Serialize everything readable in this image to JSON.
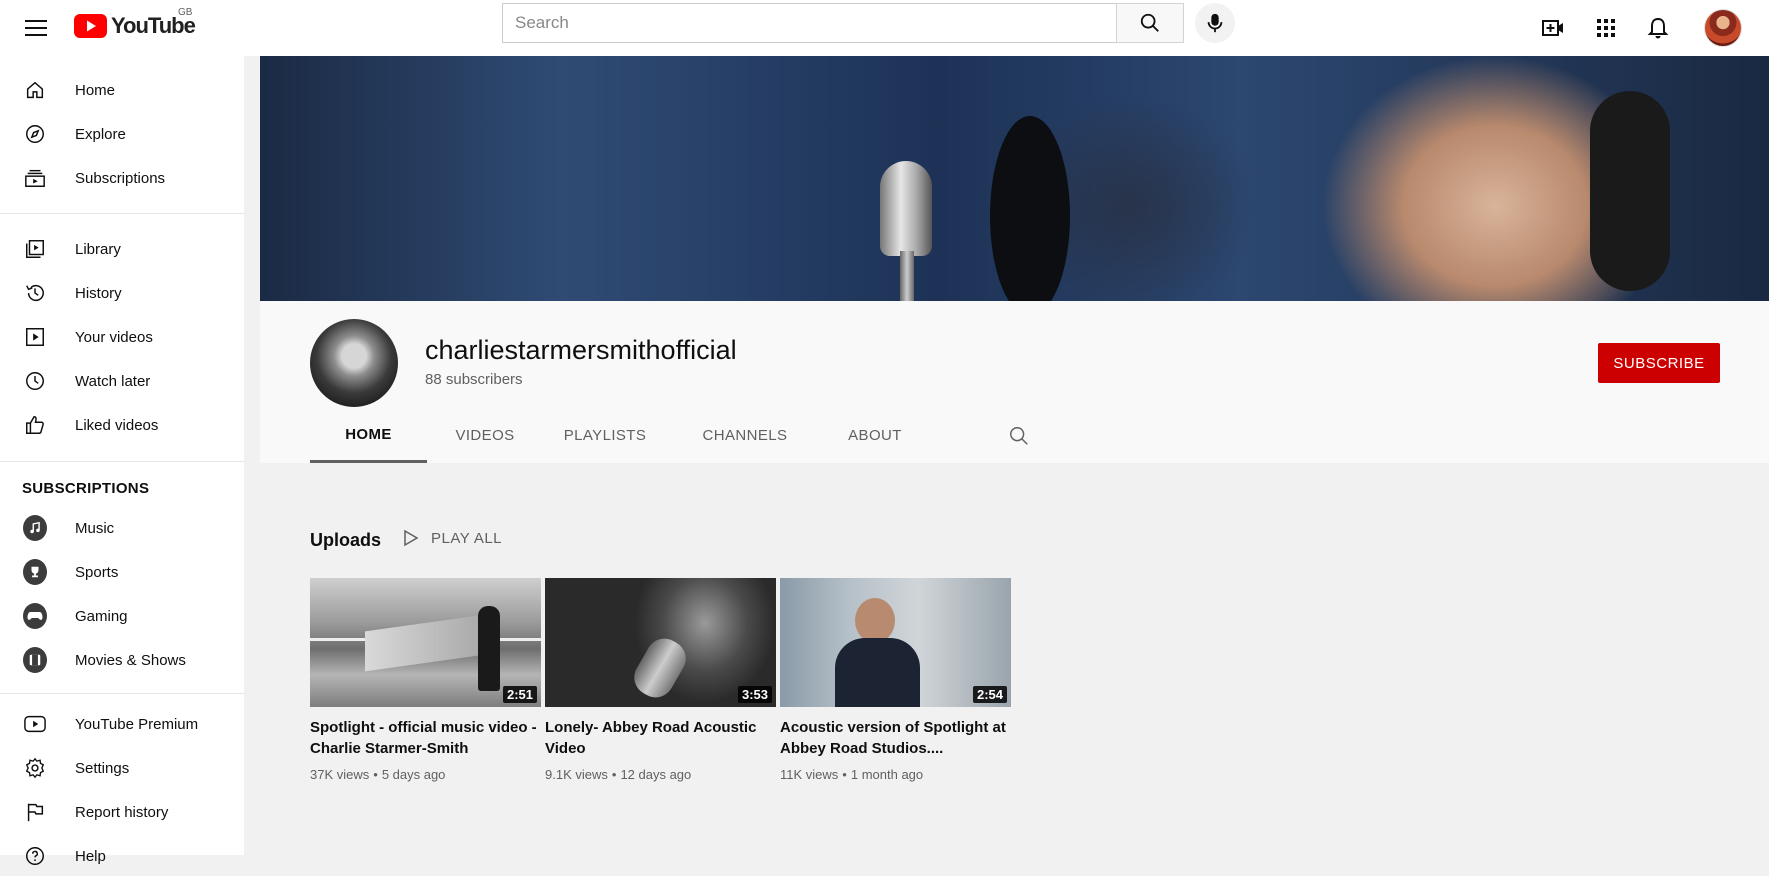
{
  "header": {
    "logo_word": "YouTube",
    "region": "GB",
    "search_placeholder": "Search",
    "icons": [
      "menu-icon",
      "search-icon",
      "mic-icon",
      "create-video-icon",
      "apps-icon",
      "bell-icon"
    ]
  },
  "sidebar": {
    "main": [
      {
        "label": "Home",
        "icon": "home-icon"
      },
      {
        "label": "Explore",
        "icon": "compass-icon"
      },
      {
        "label": "Subscriptions",
        "icon": "subscriptions-icon"
      }
    ],
    "library": [
      {
        "label": "Library",
        "icon": "library-icon"
      },
      {
        "label": "History",
        "icon": "history-icon"
      },
      {
        "label": "Your videos",
        "icon": "your-videos-icon"
      },
      {
        "label": "Watch later",
        "icon": "clock-icon"
      },
      {
        "label": "Liked videos",
        "icon": "thumbs-up-icon"
      }
    ],
    "subscriptions_heading": "SUBSCRIPTIONS",
    "subscriptions": [
      {
        "label": "Music",
        "icon": "music-icon"
      },
      {
        "label": "Sports",
        "icon": "trophy-icon"
      },
      {
        "label": "Gaming",
        "icon": "gamepad-icon"
      },
      {
        "label": "Movies & Shows",
        "icon": "film-icon"
      }
    ],
    "more": [
      {
        "label": "YouTube Premium",
        "icon": "youtube-premium-icon"
      },
      {
        "label": "Settings",
        "icon": "gear-icon"
      },
      {
        "label": "Report history",
        "icon": "flag-icon"
      },
      {
        "label": "Help",
        "icon": "help-icon"
      }
    ]
  },
  "channel": {
    "name": "charliestarmersmithofficial",
    "subscribers": "88 subscribers",
    "subscribe_label": "SUBSCRIBE",
    "tabs": [
      "HOME",
      "VIDEOS",
      "PLAYLISTS",
      "CHANNELS",
      "ABOUT"
    ],
    "active_tab": "HOME"
  },
  "uploads": {
    "title": "Uploads",
    "play_all": "PLAY ALL",
    "videos": [
      {
        "title": "Spotlight - official music video - Charlie Starmer-Smith",
        "duration": "2:51",
        "views": "37K views",
        "age": "5 days ago"
      },
      {
        "title": "Lonely- Abbey Road Acoustic Video",
        "duration": "3:53",
        "views": "9.1K views",
        "age": "12 days ago"
      },
      {
        "title": "Acoustic version of Spotlight at Abbey Road Studios....",
        "duration": "2:54",
        "views": "11K views",
        "age": "1 month ago"
      }
    ]
  },
  "colors": {
    "brand_red": "#ff0000",
    "subscribe_red": "#cc0000",
    "text_primary": "#0f0f0f",
    "text_secondary": "#606060"
  }
}
